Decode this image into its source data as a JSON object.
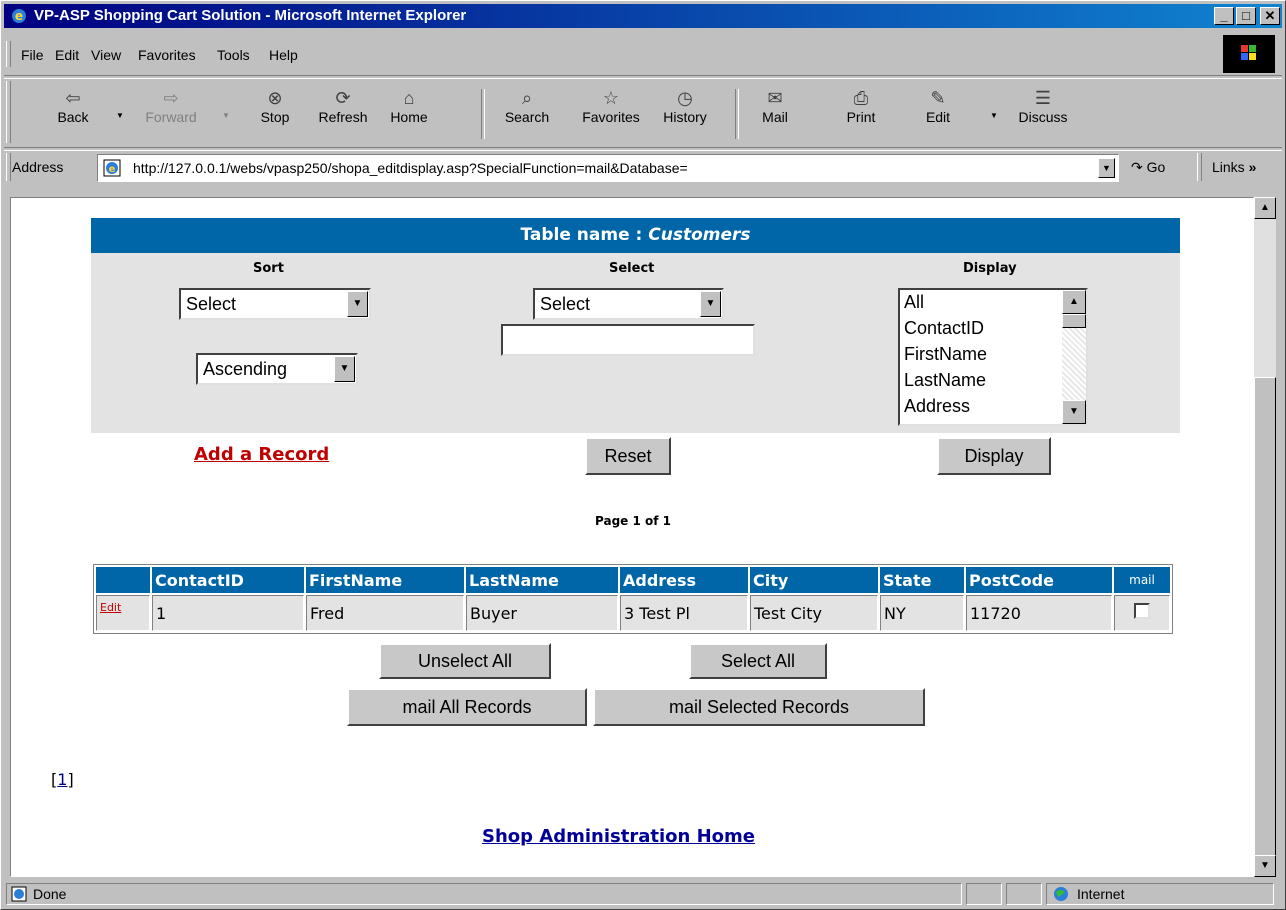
{
  "window": {
    "title": "VP-ASP Shopping Cart Solution - Microsoft Internet Explorer"
  },
  "menu": [
    "File",
    "Edit",
    "View",
    "Favorites",
    "Tools",
    "Help"
  ],
  "toolbar": {
    "back": "Back",
    "forward": "Forward",
    "stop": "Stop",
    "refresh": "Refresh",
    "home": "Home",
    "search": "Search",
    "favorites": "Favorites",
    "history": "History",
    "mail": "Mail",
    "print": "Print",
    "edit": "Edit",
    "discuss": "Discuss"
  },
  "address": {
    "label": "Address",
    "url": "http://127.0.0.1/webs/vpasp250/shopa_editdisplay.asp?SpecialFunction=mail&Database=",
    "go": "Go",
    "links": "Links"
  },
  "page": {
    "table_label": "Table name :",
    "table_name": "Customers",
    "sort": {
      "heading": "Sort",
      "field": "Select",
      "order": "Ascending"
    },
    "select": {
      "heading": "Select",
      "field": "Select",
      "value": ""
    },
    "display": {
      "heading": "Display",
      "options": [
        "All",
        "ContactID",
        "FirstName",
        "LastName",
        "Address"
      ]
    },
    "add_record": "Add a Record",
    "reset": "Reset",
    "display_button": "Display",
    "page_info": "Page 1 of 1",
    "columns": [
      "ContactID",
      "FirstName",
      "LastName",
      "Address",
      "City",
      "State",
      "PostCode",
      "mail"
    ],
    "rows": [
      {
        "edit": "Edit",
        "ContactID": "1",
        "FirstName": "Fred",
        "LastName": "Buyer",
        "Address": "3 Test Pl",
        "City": "Test City",
        "State": "NY",
        "PostCode": "11720"
      }
    ],
    "unselect_all": "Unselect All",
    "select_all": "Select All",
    "mail_all": "mail All Records",
    "mail_selected": "mail Selected Records",
    "pager_open": "[",
    "pager_page": "1",
    "pager_close": "]",
    "home_link": "Shop Administration Home "
  },
  "status": {
    "text": "Done",
    "zone": "Internet"
  }
}
